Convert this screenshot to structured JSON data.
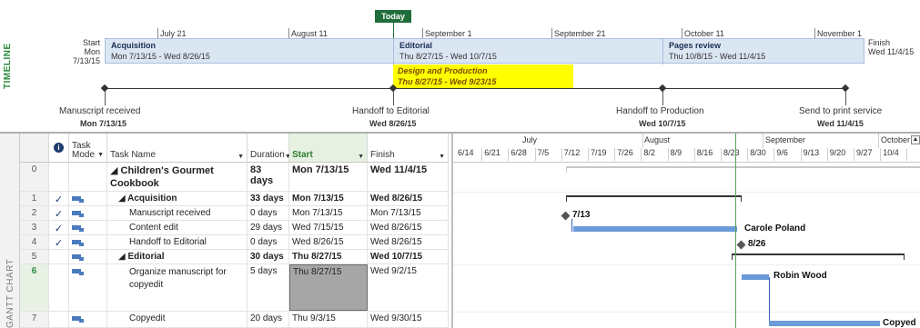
{
  "timeline": {
    "side_label": "TIMELINE",
    "today_label": "Today",
    "ticks": [
      "July 21",
      "August 11",
      "September 1",
      "September 21",
      "October 11",
      "November 1"
    ],
    "start_label": "Start",
    "start_date": "Mon 7/13/15",
    "finish_label": "Finish",
    "finish_date": "Wed 11/4/15",
    "segments": [
      {
        "title": "Acquisition",
        "dates": "Mon 7/13/15 - Wed 8/26/15"
      },
      {
        "title": "Editorial",
        "dates": "Thu 8/27/15 - Wed 10/7/15"
      },
      {
        "title": "Pages review",
        "dates": "Thu 10/8/15 - Wed 11/4/15"
      }
    ],
    "highlight": {
      "title": "Design and Production",
      "dates": "Thu 8/27/15 - Wed 9/23/15",
      "color": "#ffff00"
    },
    "milestones": [
      {
        "name": "Manuscript received",
        "date": "Mon 7/13/15"
      },
      {
        "name": "Handoff to Editorial",
        "date": "Wed 8/26/15"
      },
      {
        "name": "Handoff to Production",
        "date": "Wed 10/7/15"
      },
      {
        "name": "Send to print service",
        "date": "Wed 11/4/15"
      }
    ]
  },
  "gantt": {
    "side_label": "GANTT CHART",
    "columns": {
      "info_icon": "info-icon",
      "mode": "Task Mode",
      "name": "Task Name",
      "duration": "Duration",
      "start": "Start",
      "finish": "Finish"
    },
    "rows": [
      {
        "id": "0",
        "check": "",
        "name": "◢ Children's Gourmet Cookbook",
        "duration": "83 days",
        "start": "Mon 7/13/15",
        "finish": "Wed 11/4/15"
      },
      {
        "id": "1",
        "check": "✓",
        "name": "◢ Acquisition",
        "duration": "33 days",
        "start": "Mon 7/13/15",
        "finish": "Wed 8/26/15"
      },
      {
        "id": "2",
        "check": "✓",
        "name": "Manuscript received",
        "duration": "0 days",
        "start": "Mon 7/13/15",
        "finish": "Mon 7/13/15"
      },
      {
        "id": "3",
        "check": "✓",
        "name": "Content edit",
        "duration": "29 days",
        "start": "Wed 7/15/15",
        "finish": "Wed 8/26/15"
      },
      {
        "id": "4",
        "check": "✓",
        "name": "Handoff to Editorial",
        "duration": "0 days",
        "start": "Wed 8/26/15",
        "finish": "Wed 8/26/15"
      },
      {
        "id": "5",
        "check": "",
        "name": "◢ Editorial",
        "duration": "30 days",
        "start": "Thu 8/27/15",
        "finish": "Wed 10/7/15"
      },
      {
        "id": "6",
        "check": "",
        "name": "Organize manuscript for copyedit",
        "duration": "5 days",
        "start": "Thu 8/27/15",
        "finish": "Wed 9/2/15"
      },
      {
        "id": "7",
        "check": "",
        "name": "Copyedit",
        "duration": "20 days",
        "start": "Thu 9/3/15",
        "finish": "Wed 9/30/15"
      }
    ],
    "chart": {
      "months": [
        "July",
        "August",
        "September",
        "October"
      ],
      "weeks": [
        "6/14",
        "6/21",
        "6/28",
        "7/5",
        "7/12",
        "7/19",
        "7/26",
        "8/2",
        "8/9",
        "8/16",
        "8/23",
        "8/30",
        "9/6",
        "9/13",
        "9/20",
        "9/27",
        "10/4"
      ],
      "labels": {
        "ms_manuscript": "7/13",
        "res_content": "Carole Poland",
        "ms_handoff": "8/26",
        "res_organize": "Robin Wood",
        "res_copyedit": "Copyed"
      }
    }
  }
}
